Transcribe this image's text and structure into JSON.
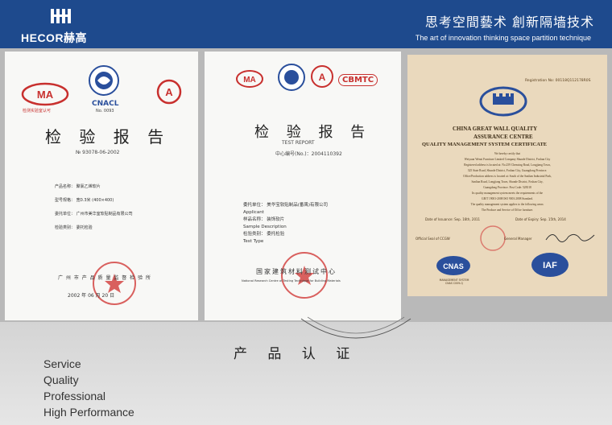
{
  "header": {
    "brand": "HECOR赫高",
    "slogan_cn": "思考空間藝术 創新隔墙技术",
    "slogan_en": "The art of innovation thinking space partition technique"
  },
  "doc1": {
    "seal_cma": "CMA",
    "seal_cnacl": "CNACL",
    "seal_cnacl_no": "No. 0093",
    "seal_ca": "CAL",
    "title": "检 验 报 告",
    "number": "№ 93078-06-2002",
    "lines": [
      "产品名称：  聚氯乙烯软片",
      "型号规格：  宽0.3米 (400×400)",
      "委托单位：  广州市美华室软贴制品有限公司",
      "检验类别：  委托检验"
    ],
    "institute": "广 州 市 产 品 质 量 监 督 检 验 所",
    "date": "2002 年  06 月 20 日"
  },
  "doc2": {
    "seal_cma": "CMA",
    "seal_cbmtc": "CBMTC",
    "title": "检 验 报 告",
    "subtitle": "TEST REPORT",
    "number": "中心编号(No.)：2004110392",
    "lines": [
      "委托单位：  美华宝软贴制品(番禺)有限公司",
      "Applicant",
      "样品名称：  装饰软片",
      "Sample Description",
      "检验类别：  委托检验",
      "Test Type"
    ],
    "center_cn": "国家建筑材料测试中心",
    "center_en": "National Research Centre of Testing Technique for Building Materials"
  },
  "doc3": {
    "reg_no": "Registration No: 00118Q112178R0S",
    "title1": "CHINA GREAT WALL QUALITY",
    "title2": "ASSURANCE CENTRE",
    "title3": "QUALITY MANAGEMENT SYSTEM CERTIFICATE",
    "body": [
      "We hereby certify that",
      "Weiyuan Wenzi Furniture Limited Company Shunde District, Foshan City",
      "Registered address is located at: No.259 Chenxing Road, Longjiang Town,",
      "325 State Road, Shunde District, Foshan City, Guangdong Province.",
      "Office/Production address is located at: South of the Sanlian Industrial Park,",
      "Sanlian Road, Longjiang Town, Shunde District, Foshan City,",
      "Guangdong Province.     Post Code: 528318",
      "Its quality management system meets the requirements of the",
      "GB/T 19001-2008 ISO 9001:2008 Standard.",
      "The quality management system applies to the following areas:",
      "The Produce and Service of Office furniture."
    ],
    "date_issue": "Date of Issuance: Sep. 16th, 2011",
    "date_expiry": "Date of Expiry: Sep. 15th, 2014",
    "seal_label": "Official Seal of CCGW",
    "manager_label": "General Manager",
    "cnas": "CNAS",
    "cnas_sub": "MANAGEMENT SYSTEM CNAS C009-Q",
    "iaf": "IAF"
  },
  "section_title": "产 品 认 证",
  "service_list": [
    "Service",
    "Quality",
    "Professional",
    "High Performance"
  ]
}
